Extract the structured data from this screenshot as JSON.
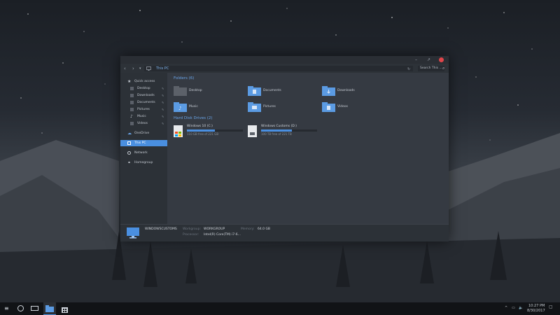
{
  "window": {
    "address": "This PC",
    "search_placeholder": "Search This ...",
    "controls": [
      "minimize-icon",
      "maximize-icon",
      "close-icon"
    ]
  },
  "sidebar": {
    "items": [
      {
        "label": "Quick access",
        "icon": "star-icon",
        "pinned": false
      },
      {
        "label": "Desktop",
        "icon": "folder-icon",
        "pinned": true
      },
      {
        "label": "Downloads",
        "icon": "download-icon",
        "pinned": true
      },
      {
        "label": "Documents",
        "icon": "document-icon",
        "pinned": true
      },
      {
        "label": "Pictures",
        "icon": "picture-icon",
        "pinned": true
      },
      {
        "label": "Music",
        "icon": "music-icon",
        "pinned": true
      },
      {
        "label": "Videos",
        "icon": "video-icon",
        "pinned": true
      },
      {
        "label": "OneDrive",
        "icon": "cloud-icon",
        "pinned": false
      },
      {
        "label": "This PC",
        "icon": "monitor-icon",
        "pinned": false,
        "active": true
      },
      {
        "label": "Network",
        "icon": "network-icon",
        "pinned": false
      },
      {
        "label": "Homegroup",
        "icon": "homegroup-icon",
        "pinned": false
      }
    ]
  },
  "content": {
    "folders_heading": "Folders (6)",
    "folders": [
      {
        "label": "Desktop",
        "icon": "desktop-folder-icon"
      },
      {
        "label": "Documents",
        "icon": "documents-folder-icon"
      },
      {
        "label": "Downloads",
        "icon": "downloads-folder-icon"
      },
      {
        "label": "Music",
        "icon": "music-folder-icon"
      },
      {
        "label": "Pictures",
        "icon": "pictures-folder-icon"
      },
      {
        "label": "Videos",
        "icon": "videos-folder-icon"
      }
    ],
    "drives_heading": "Hard Disk Drives (2)",
    "drives": [
      {
        "name": "Windows 10 (C:)",
        "free": "110 GB free of 221 GB",
        "used_fraction": 0.5
      },
      {
        "name": "Windows Customs (D:)",
        "free": "100 TB free of 221 TB",
        "used_fraction": 0.55
      }
    ]
  },
  "details": {
    "computer_name": "WINDOWSCUSTOMS",
    "workgroup_key": "Workgroup:",
    "workgroup_value": "WORKGROUP",
    "memory_key": "Memory:",
    "memory_value": "64.0 GB",
    "processor_key": "Processor:",
    "processor_value": "Intel(R) Core(TM) i7-6..."
  },
  "taskbar": {
    "time": "10:27 PM",
    "date": "8/30/2017"
  },
  "colors": {
    "accent": "#4a8fe0",
    "close": "#e0454a",
    "window_bg": "#353a42"
  }
}
